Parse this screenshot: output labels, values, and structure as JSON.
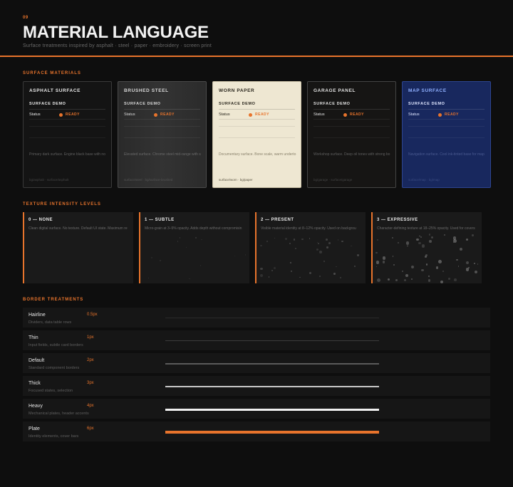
{
  "header": {
    "kicker": "09",
    "title": "MATERIAL LANGUAGE",
    "subtitle": "Surface treatments inspired by asphalt · steel · paper · embroidery · screen print"
  },
  "colors": {
    "accent": "#e8742c",
    "background": "#0e0e0e"
  },
  "surface_section": {
    "label": "SURFACE MATERIALS",
    "cards": [
      {
        "title": "ASPHALT SURFACE",
        "sub": "SURFACE DEMO",
        "status_label": "Status",
        "status_value": "READY",
        "desc": "Primary dark surface. Engine black base with no",
        "foot": "bg/asphalt · surface/asphalt"
      },
      {
        "title": "BRUSHED STEEL",
        "sub": "SURFACE DEMO",
        "status_label": "Status",
        "status_value": "READY",
        "desc": "Elevated surface. Chrome steel mid-range with s",
        "foot": "surface/steel · bg/surface-brushed"
      },
      {
        "title": "WORN PAPER",
        "sub": "SURFACE DEMO",
        "status_label": "Status",
        "status_value": "READY",
        "desc": "Documentary surface. Bone scale, warm underto",
        "foot": "surface/worn · bg/paper"
      },
      {
        "title": "GARAGE PANEL",
        "sub": "SURFACE DEMO",
        "status_label": "Status",
        "status_value": "READY",
        "desc": "Workshop surface. Deep oil tones with strong bo",
        "foot": "bg/garage · surface/garage"
      },
      {
        "title": "MAP SURFACE",
        "sub": "SURFACE DEMO",
        "status_label": "Status",
        "status_value": "READY",
        "desc": "Navigation surface. Cool ink-tinted base for map",
        "foot": "surface/map · bg/map"
      }
    ]
  },
  "texture_section": {
    "label": "TEXTURE INTENSITY LEVELS",
    "levels": [
      {
        "title": "0 — NONE",
        "desc": "Clean digital surface. No texture. Default UI state. Maximum re"
      },
      {
        "title": "1 — SUBTLE",
        "desc": "Micro-grain at 3–5% opacity. Adds depth without compromisin"
      },
      {
        "title": "2 — PRESENT",
        "desc": "Visible material identity at 8–12% opacity. Used on backgrou"
      },
      {
        "title": "3 — EXPRESSIVE",
        "desc": "Character-defining texture at 18–25% opacity. Used for covers"
      }
    ]
  },
  "border_section": {
    "label": "BORDER TREATMENTS",
    "rows": [
      {
        "name": "Hairline",
        "px": "0.5px",
        "desc": "Dividers, data table rows"
      },
      {
        "name": "Thin",
        "px": "1px",
        "desc": "Input fields, subtle card borders"
      },
      {
        "name": "Default",
        "px": "2px",
        "desc": "Standard component borders"
      },
      {
        "name": "Thick",
        "px": "3px",
        "desc": "Focused states, selection"
      },
      {
        "name": "Heavy",
        "px": "4px",
        "desc": "Mechanical plates, header accents"
      },
      {
        "name": "Plate",
        "px": "6px",
        "desc": "Identity elements, cover bars"
      }
    ]
  }
}
